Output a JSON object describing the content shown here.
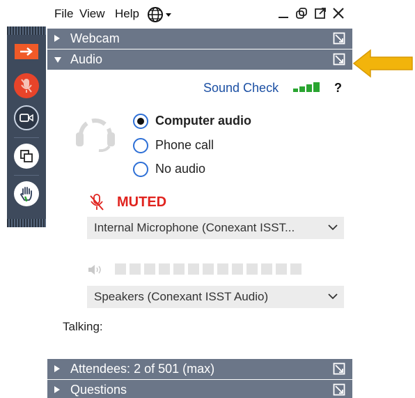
{
  "menu": {
    "file": "File",
    "view": "View",
    "help": "Help"
  },
  "sections": {
    "webcam": "Webcam",
    "audio": "Audio",
    "attendees": "Attendees: 2 of 501 (max)",
    "questions": "Questions"
  },
  "audio": {
    "sound_check": "Sound Check",
    "help_mark": "?",
    "options": [
      {
        "label": "Computer audio",
        "selected": true
      },
      {
        "label": "Phone call",
        "selected": false
      },
      {
        "label": "No audio",
        "selected": false
      }
    ],
    "mute_status": "MUTED",
    "microphone": "Internal Microphone (Conexant ISST...",
    "speakers": "Speakers (Conexant ISST Audio)",
    "talking": "Talking:"
  },
  "colors": {
    "toolbar_bg": "#3e4a5c",
    "section_bar": "#6b7688",
    "accent_orange": "#f05a28",
    "muted_red": "#e0231e",
    "link_blue": "#1b4fa3",
    "signal_green": "#2aa531",
    "callout_arrow": "#f2b40b"
  },
  "icons": [
    "collapse-arrow-icon",
    "microphone-muted-icon",
    "camera-icon",
    "share-screen-icon",
    "raise-hand-icon",
    "globe-icon",
    "minimize-icon",
    "restore-icon",
    "popout-icon",
    "close-icon",
    "headset-icon",
    "speaker-icon",
    "chevron-down-icon"
  ]
}
